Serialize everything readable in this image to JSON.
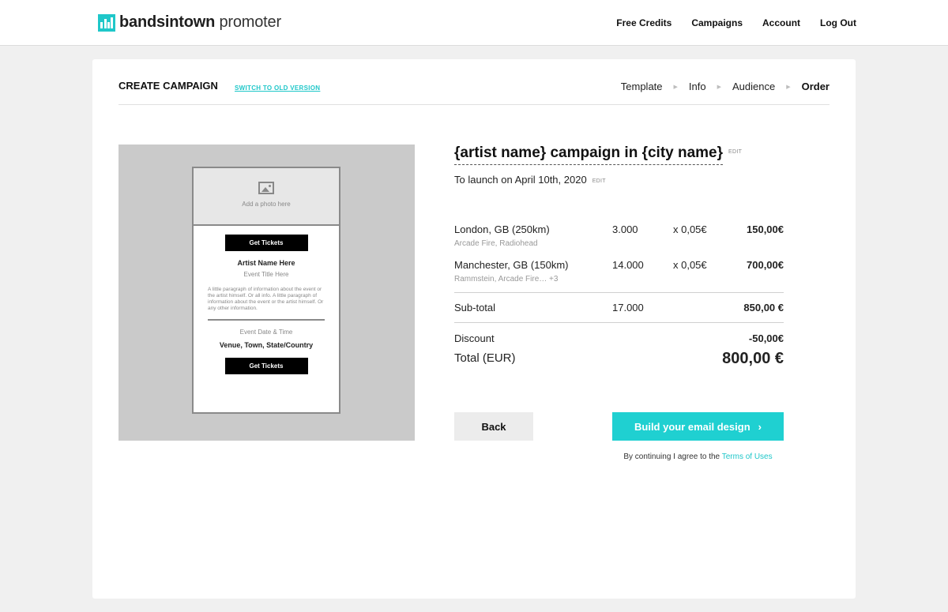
{
  "header": {
    "logo_bold": "bandsintown",
    "logo_light": "promoter",
    "nav": [
      "Free Credits",
      "Campaigns",
      "Account",
      "Log Out"
    ]
  },
  "page": {
    "title": "CREATE CAMPAIGN",
    "switch_label": "SWITCH TO OLD VERSION",
    "steps": [
      "Template",
      "Info",
      "Audience",
      "Order"
    ],
    "active_step": "Order"
  },
  "preview": {
    "photo_text": "Add a photo here",
    "cta_label": "Get Tickets",
    "artist": "Artist Name Here",
    "event_title": "Event Title Here",
    "paragraph": "A little paragraph of information about the event or the artist himself. Or all info. A little paragraph of information about the event or the artist himself. Or any other information.",
    "event_date": "Event Date & Time",
    "venue": "Venue, Town, State/Country"
  },
  "campaign": {
    "title": "{artist name} campaign in {city name}",
    "edit_label": "EDIT",
    "launch": "To launch on April 10th, 2020",
    "rows": [
      {
        "city": "London, GB (250km)",
        "artists": "Arcade Fire, Radiohead",
        "qty": "3.000",
        "rate": "x 0,05€",
        "amount": "150,00€"
      },
      {
        "city": "Manchester, GB (150km)",
        "artists": "Rammstein, Arcade Fire… +3",
        "qty": "14.000",
        "rate": "x 0,05€",
        "amount": "700,00€"
      }
    ],
    "subtotal": {
      "label": "Sub-total",
      "qty": "17.000",
      "amount": "850,00 €"
    },
    "discount": {
      "label": "Discount",
      "amount": "-50,00€"
    },
    "total": {
      "label": "Total (EUR)",
      "amount": "800,00 €"
    }
  },
  "actions": {
    "back": "Back",
    "build": "Build your email design",
    "terms_prefix": "By continuing I agree to the",
    "terms_link": "Terms of Uses"
  },
  "colors": {
    "accent": "#1fc7c9",
    "button": "#1fd0d1"
  }
}
